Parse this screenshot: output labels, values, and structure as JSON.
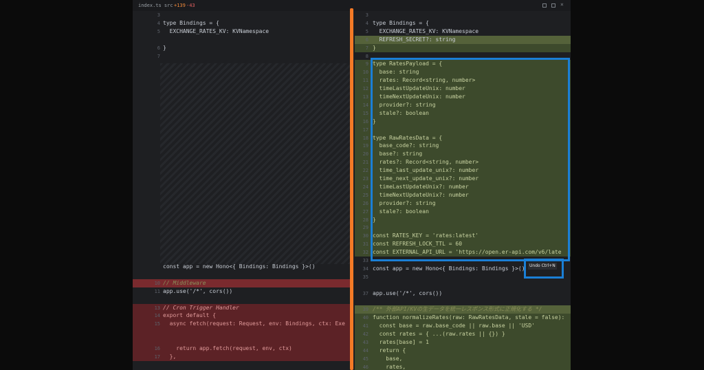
{
  "titlebar": {
    "file": "index.ts src",
    "added": "+139",
    "removed": "-43"
  },
  "left_lines": [
    {
      "n": "3",
      "t": "",
      "k": ""
    },
    {
      "n": "4",
      "t": "type Bindings = {",
      "k": ""
    },
    {
      "n": "5",
      "t": "  EXCHANGE_RATES_KV: KVNamespace",
      "k": ""
    },
    {
      "n": "",
      "t": "",
      "k": ""
    },
    {
      "n": "6",
      "t": "}",
      "k": ""
    },
    {
      "n": "7",
      "t": "",
      "k": ""
    }
  ],
  "left_bottom": [
    {
      "n": "",
      "t": "const app = new Hono<{ Bindings: Bindings }>()",
      "k": ""
    },
    {
      "n": "",
      "t": "",
      "k": ""
    },
    {
      "n": "10",
      "t": "// Middleware",
      "k": "del-strong comment"
    },
    {
      "n": "11",
      "t": "app.use('/*', cors())",
      "k": ""
    },
    {
      "n": "",
      "t": "",
      "k": ""
    },
    {
      "n": "13",
      "t": "// Cron Trigger Handler",
      "k": "del comment"
    },
    {
      "n": "14",
      "t": "export default {",
      "k": "del"
    },
    {
      "n": "15",
      "t": "  async fetch(request: Request, env: Bindings, ctx: Exe",
      "k": "del"
    },
    {
      "n": "",
      "t": "",
      "k": "del"
    },
    {
      "n": "",
      "t": "",
      "k": "del"
    },
    {
      "n": "16",
      "t": "    return app.fetch(request, env, ctx)",
      "k": "del"
    },
    {
      "n": "17",
      "t": "  },",
      "k": "del"
    }
  ],
  "right_lines": [
    {
      "n": "3",
      "t": "",
      "k": ""
    },
    {
      "n": "4",
      "t": "type Bindings = {",
      "k": ""
    },
    {
      "n": "5",
      "t": "  EXCHANGE_RATES_KV: KVNamespace",
      "k": ""
    },
    {
      "n": "6",
      "t": "  REFRESH_SECRET?: string",
      "k": "add-strong"
    },
    {
      "n": "7",
      "t": "}",
      "k": "add"
    },
    {
      "n": "8",
      "t": "",
      "k": ""
    },
    {
      "n": "9",
      "t": "type RatesPayload = {",
      "k": "add"
    },
    {
      "n": "10",
      "t": "  base: string",
      "k": "add"
    },
    {
      "n": "11",
      "t": "  rates: Record<string, number>",
      "k": "add"
    },
    {
      "n": "12",
      "t": "  timeLastUpdateUnix: number",
      "k": "add"
    },
    {
      "n": "13",
      "t": "  timeNextUpdateUnix: number",
      "k": "add"
    },
    {
      "n": "14",
      "t": "  provider?: string",
      "k": "add"
    },
    {
      "n": "15",
      "t": "  stale?: boolean",
      "k": "add"
    },
    {
      "n": "16",
      "t": "}",
      "k": "add"
    },
    {
      "n": "17",
      "t": "",
      "k": "add"
    },
    {
      "n": "18",
      "t": "type RawRatesData = {",
      "k": "add"
    },
    {
      "n": "19",
      "t": "  base_code?: string",
      "k": "add"
    },
    {
      "n": "20",
      "t": "  base?: string",
      "k": "add"
    },
    {
      "n": "21",
      "t": "  rates?: Record<string, number>",
      "k": "add"
    },
    {
      "n": "22",
      "t": "  time_last_update_unix?: number",
      "k": "add"
    },
    {
      "n": "23",
      "t": "  time_next_update_unix?: number",
      "k": "add"
    },
    {
      "n": "24",
      "t": "  timeLastUpdateUnix?: number",
      "k": "add"
    },
    {
      "n": "25",
      "t": "  timeNextUpdateUnix?: number",
      "k": "add"
    },
    {
      "n": "26",
      "t": "  provider?: string",
      "k": "add"
    },
    {
      "n": "27",
      "t": "  stale?: boolean",
      "k": "add"
    },
    {
      "n": "28",
      "t": "}",
      "k": "add"
    },
    {
      "n": "29",
      "t": "",
      "k": "add"
    },
    {
      "n": "30",
      "t": "const RATES_KEY = 'rates:latest'",
      "k": "add"
    },
    {
      "n": "31",
      "t": "const REFRESH_LOCK_TTL = 60",
      "k": "add"
    },
    {
      "n": "32",
      "t": "const EXTERNAL_API_URL = 'https://open.er-api.com/v6/late",
      "k": "add"
    },
    {
      "n": "33",
      "t": "",
      "k": ""
    },
    {
      "n": "34",
      "t": "const app = new Hono<{ Bindings: Bindings }>()",
      "k": ""
    },
    {
      "n": "35",
      "t": "",
      "k": ""
    },
    {
      "n": "",
      "t": "",
      "k": ""
    },
    {
      "n": "37",
      "t": "app.use('/*', cors())",
      "k": ""
    },
    {
      "n": "",
      "t": "",
      "k": ""
    },
    {
      "n": "39",
      "t": "/** 外部API/KVの生データを統一レスポンス形式に正規化する */",
      "k": "add-strong comment"
    },
    {
      "n": "40",
      "t": "function normalizeRates(raw: RawRatesData, stale = false):",
      "k": "add"
    },
    {
      "n": "41",
      "t": "  const base = raw.base_code || raw.base || 'USD'",
      "k": "add"
    },
    {
      "n": "42",
      "t": "  const rates = { ...(raw.rates || {}) }",
      "k": "add"
    },
    {
      "n": "43",
      "t": "  rates[base] = 1",
      "k": "add"
    },
    {
      "n": "44",
      "t": "  return {",
      "k": "add"
    },
    {
      "n": "45",
      "t": "    base,",
      "k": "add"
    },
    {
      "n": "46",
      "t": "    rates,",
      "k": "add"
    }
  ],
  "tooltip": {
    "text": "Undo Ctrl+N"
  },
  "colors": {
    "accent_divider": "#f47a26",
    "highlight": "#1a7fd6",
    "added_bg": "#3d4a2c",
    "removed_bg": "#5c2226"
  }
}
